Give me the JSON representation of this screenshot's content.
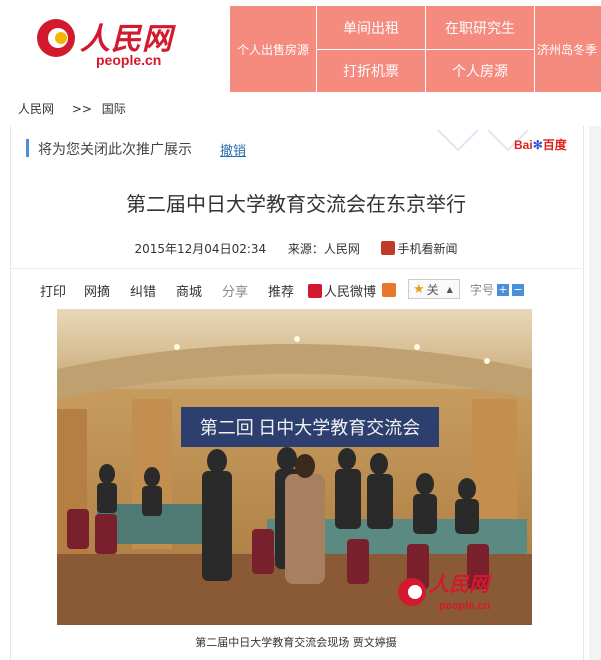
{
  "header": {
    "logo_text": "人民网",
    "logo_sub": "people.cn",
    "ads": [
      {
        "label": "个人出售房源"
      },
      {
        "label": "单间出租"
      },
      {
        "label": "在职研究生"
      },
      {
        "label": "打折机票"
      },
      {
        "label": "个人房源"
      },
      {
        "label": "济州岛冬季"
      }
    ],
    "ad_color": "#f58a7f"
  },
  "breadcrumb": {
    "home": "人民网",
    "sep": ">>",
    "section": "国际"
  },
  "promo": {
    "text": "将为您关闭此次推广展示",
    "undo": "撤销",
    "baidu": "Bai",
    "baidu2": "百度"
  },
  "article": {
    "title": "第二届中日大学教育交流会在东京举行",
    "date": "2015年12月04日02:34",
    "source": "来源：人民网",
    "mobile": "手机看新闻",
    "photo_banner": "第二回 日中大学教育交流会",
    "caption": "第二届中日大学教育交流会现场 贾文婷摄",
    "watermark": "人民网",
    "watermark_sub": "people.cn"
  },
  "toolbar": {
    "print": "打印",
    "excerpt": "网摘",
    "correct": "纠错",
    "mall": "商城",
    "share": "分享",
    "recommend": "推荐",
    "weibo": "人民微博",
    "follow": "关",
    "font_label": "字号",
    "font_plus": "+",
    "font_minus": "−"
  }
}
